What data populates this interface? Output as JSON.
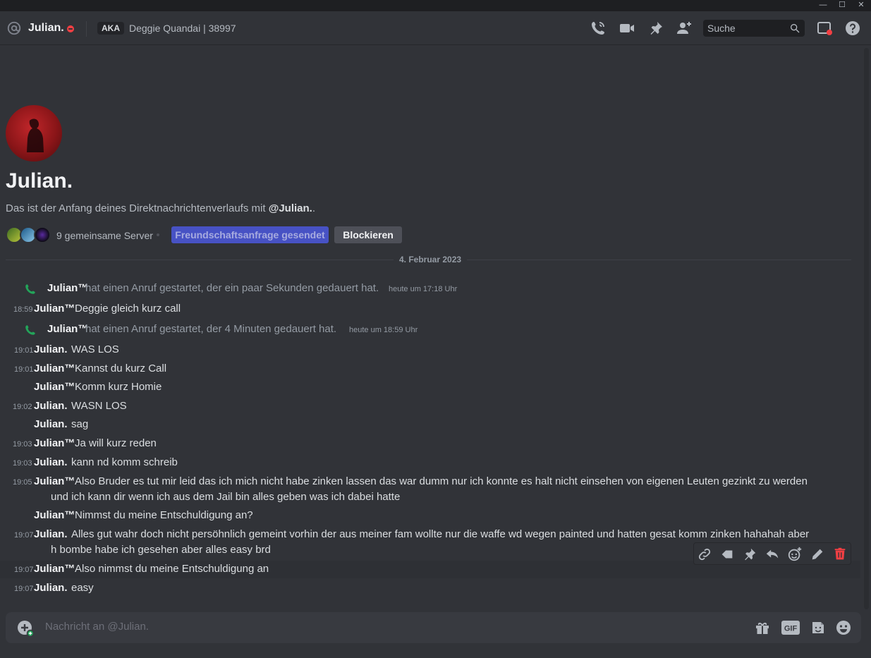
{
  "window": {
    "minimize": "—",
    "maximize": "☐",
    "close": "✕"
  },
  "header": {
    "name": "Julian.",
    "aka_badge": "AKA",
    "aka_names": "Deggie Quandai | 38997",
    "search_placeholder": "Suche"
  },
  "profile": {
    "name": "Julian.",
    "intro_prefix": "Das ist der Anfang deines Direktnachrichtenverlaufs mit ",
    "intro_handle": "@Julian.",
    "intro_suffix": ".",
    "mutual_servers": "9 gemeinsame Server",
    "friend_request_button": "Freundschaftsanfrage gesendet",
    "block_button": "Blockieren"
  },
  "date_divider": "4. Februar 2023",
  "messages": [
    {
      "type": "call",
      "author": "Julian™",
      "text": "hat einen Anruf gestartet, der ein paar Sekunden gedauert hat.",
      "time": "heute um 17:18 Uhr"
    },
    {
      "type": "msg",
      "time": "18:59",
      "author": "Julian™",
      "lines": [
        "Deggie gleich kurz call"
      ]
    },
    {
      "type": "call",
      "author": "Julian™",
      "text": "hat einen Anruf gestartet, der 4 Minuten gedauert hat.",
      "time": "heute um 18:59 Uhr"
    },
    {
      "type": "msg",
      "time": "19:01",
      "author": "Julian.",
      "lines": [
        "WAS LOS"
      ]
    },
    {
      "type": "msg",
      "time": "19:01",
      "author": "Julian™",
      "lines": [
        "Kannst du kurz Call"
      ]
    },
    {
      "type": "msg",
      "time": "",
      "author": "Julian™",
      "lines": [
        "Komm kurz Homie"
      ]
    },
    {
      "type": "msg",
      "time": "19:02",
      "author": "Julian.",
      "lines": [
        "WASN LOS"
      ]
    },
    {
      "type": "msg",
      "time": "",
      "author": "Julian.",
      "lines": [
        "sag"
      ]
    },
    {
      "type": "msg",
      "time": "19:03",
      "author": "Julian™",
      "lines": [
        "Ja will kurz reden"
      ]
    },
    {
      "type": "msg",
      "time": "19:03",
      "author": "Julian.",
      "lines": [
        "kann nd komm schreib"
      ]
    },
    {
      "type": "msg",
      "time": "19:05",
      "author": "Julian™",
      "lines": [
        "Also Bruder es tut mir leid das ich mich nicht habe zinken lassen das war dumm nur ich konnte es halt nicht einsehen von eigenen Leuten gezinkt zu werden",
        "und ich kann dir wenn ich aus dem Jail bin alles geben was ich dabei hatte"
      ]
    },
    {
      "type": "msg",
      "time": "",
      "author": "Julian™",
      "lines": [
        "Nimmst du meine Entschuldigung an?"
      ]
    },
    {
      "type": "msg",
      "time": "19:07",
      "author": "Julian.",
      "lines": [
        "Alles gut wahr doch nicht persöhnlich gemeint vorhin der aus meiner fam wollte nur die  waffe wd wegen painted und hatten gesat komm zinken hahahah aber",
        "h bombe habe ich gesehen aber alles easy brd"
      ]
    },
    {
      "type": "msg",
      "time": "19:07",
      "author": "Julian™",
      "lines": [
        "Also nimmst du meine Entschuldigung an"
      ]
    },
    {
      "type": "msg",
      "time": "19:07",
      "author": "Julian.",
      "lines": [
        "easy"
      ]
    }
  ],
  "composer": {
    "placeholder": "Nachricht an @Julian.",
    "gif_label": "GIF"
  },
  "colors": {
    "accent_blurple": "#5865f2",
    "call_green": "#23a55a",
    "dnd_red": "#f23f43",
    "danger": "#f23f43"
  }
}
